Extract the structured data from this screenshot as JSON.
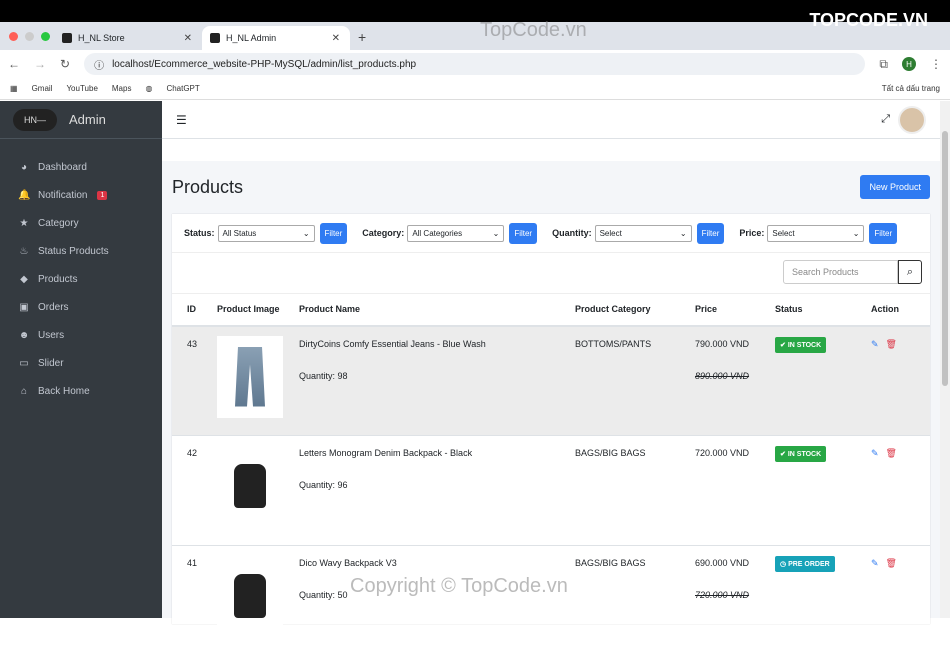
{
  "browser": {
    "tabs": [
      {
        "title": "H_NL Store"
      },
      {
        "title": "H_NL Admin"
      }
    ],
    "url": "localhost/Ecommerce_website-PHP-MySQL/admin/list_products.php",
    "bookmarks": [
      "Gmail",
      "YouTube",
      "Maps",
      "ChatGPT"
    ],
    "all_bookmarks": "Tất cả dấu trang",
    "profile": "H"
  },
  "sidebar": {
    "logo": "HN—",
    "brand": "Admin",
    "items": [
      {
        "label": "Dashboard",
        "icon": "gauge-icon",
        "glyph": "◕"
      },
      {
        "label": "Notification",
        "icon": "bell-icon",
        "glyph": "🔔",
        "badge": "1"
      },
      {
        "label": "Category",
        "icon": "star-icon",
        "glyph": "★"
      },
      {
        "label": "Status Products",
        "icon": "fire-icon",
        "glyph": "♨"
      },
      {
        "label": "Products",
        "icon": "tag-icon",
        "glyph": "◆"
      },
      {
        "label": "Orders",
        "icon": "shopping-bag-icon",
        "glyph": "▣"
      },
      {
        "label": "Users",
        "icon": "users-icon",
        "glyph": "☻"
      },
      {
        "label": "Slider",
        "icon": "image-icon",
        "glyph": "▭"
      },
      {
        "label": "Back Home",
        "icon": "home-icon",
        "glyph": "⌂"
      }
    ]
  },
  "page": {
    "title": "Products",
    "new_button": "New Product"
  },
  "filters": [
    {
      "label": "Status:",
      "value": "All Status"
    },
    {
      "label": "Category:",
      "value": "All Categories"
    },
    {
      "label": "Quantity:",
      "value": "Select"
    },
    {
      "label": "Price:",
      "value": "Select"
    }
  ],
  "filter_button": "Filter",
  "search": {
    "placeholder": "Search Products"
  },
  "table": {
    "headers": [
      "ID",
      "Product Image",
      "Product Name",
      "Product Category",
      "Price",
      "Status",
      "Action"
    ],
    "rows": [
      {
        "id": "43",
        "name": "DirtyCoins Comfy Essential Jeans - Blue Wash",
        "quantity": "Quantity: 98",
        "category": "BOTTOMS/PANTS",
        "price": "790.000 VND",
        "old_price": "890.000 VND",
        "status": "IN STOCK"
      },
      {
        "id": "42",
        "name": "Letters Monogram Denim Backpack - Black",
        "quantity": "Quantity: 96",
        "category": "BAGS/BIG BAGS",
        "price": "720.000 VND",
        "old_price": "",
        "status": "IN STOCK"
      },
      {
        "id": "41",
        "name": "Dico Wavy Backpack V3",
        "quantity": "Quantity: 50",
        "category": "BAGS/BIG BAGS",
        "price": "690.000 VND",
        "old_price": "720.000 VND",
        "status": "PRE ORDER"
      }
    ]
  },
  "colors": {
    "primary": "#2f7bf2",
    "in_stock": "#28a745",
    "pre_order": "#17a2b8",
    "sidebar": "#343a40",
    "delete": "#dc3545"
  },
  "watermark": [
    "TopCode.vn",
    "Copyright © TopCode.vn",
    "TOPCODE.VN"
  ]
}
